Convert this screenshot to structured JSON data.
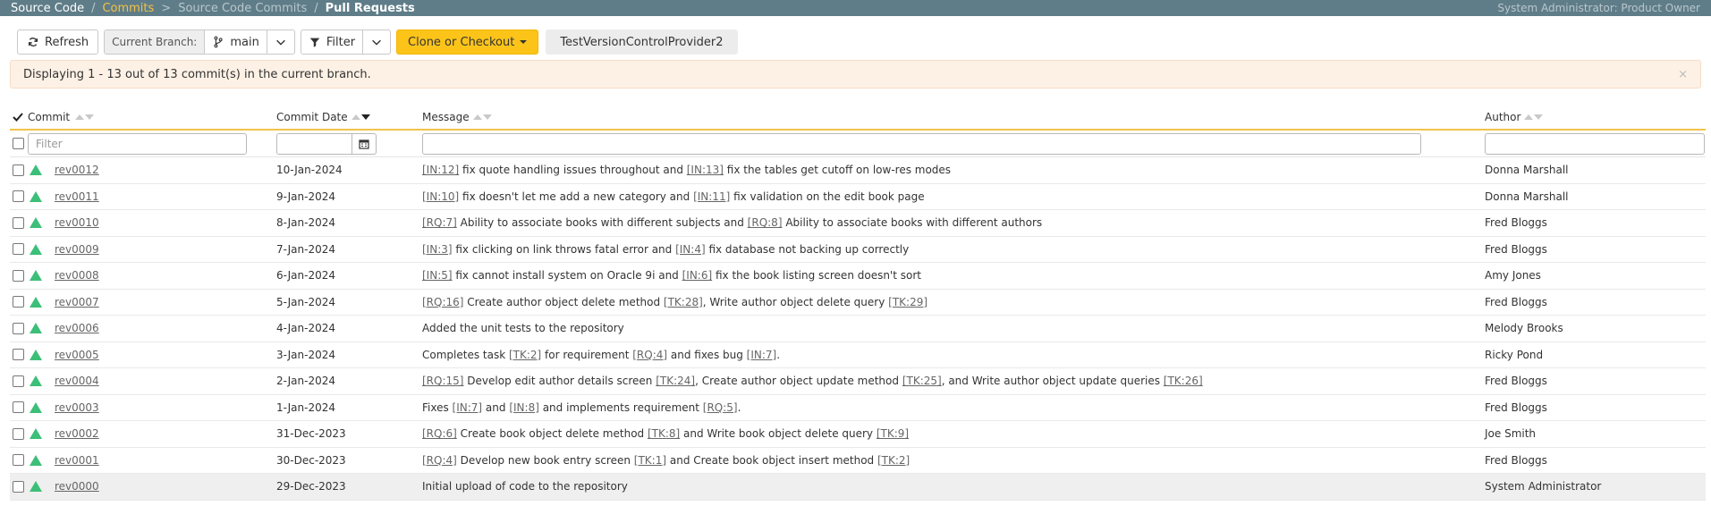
{
  "breadcrumb": {
    "items": [
      "Source Code",
      "Commits",
      "Source Code Commits",
      "Pull Requests"
    ],
    "separators": [
      "/",
      ">",
      "/"
    ]
  },
  "user": "System Administrator: Product Owner",
  "toolbar": {
    "refresh": "Refresh",
    "current_branch_label": "Current Branch:",
    "branch": "main",
    "filter": "Filter",
    "clone": "Clone or Checkout",
    "provider": "TestVersionControlProvider2"
  },
  "alert": {
    "text": "Displaying 1 - 13 out of 13 commit(s) in the current branch.",
    "close": "×"
  },
  "columns": {
    "commit": "Commit",
    "date": "Commit Date",
    "message": "Message",
    "author": "Author"
  },
  "filters": {
    "commit_placeholder": "Filter"
  },
  "rows": [
    {
      "rev": "rev0012",
      "date": "10-Jan-2024",
      "author": "Donna Marshall",
      "msg": [
        {
          "t": "IN:12",
          "l": true
        },
        {
          "t": " fix quote handling issues throughout and "
        },
        {
          "t": "IN:13",
          "l": true
        },
        {
          "t": " fix the tables get cutoff on low-res modes"
        }
      ]
    },
    {
      "rev": "rev0011",
      "date": "9-Jan-2024",
      "author": "Donna Marshall",
      "msg": [
        {
          "t": "IN:10",
          "l": true
        },
        {
          "t": " fix doesn't let me add a new category and "
        },
        {
          "t": "IN:11",
          "l": true
        },
        {
          "t": " fix validation on the edit book page"
        }
      ]
    },
    {
      "rev": "rev0010",
      "date": "8-Jan-2024",
      "author": "Fred Bloggs",
      "msg": [
        {
          "t": "RQ:7",
          "l": true
        },
        {
          "t": " Ability to associate books with different subjects and "
        },
        {
          "t": "RQ:8",
          "l": true
        },
        {
          "t": " Ability to associate books with different authors"
        }
      ]
    },
    {
      "rev": "rev0009",
      "date": "7-Jan-2024",
      "author": "Fred Bloggs",
      "msg": [
        {
          "t": "IN:3",
          "l": true
        },
        {
          "t": " fix clicking on link throws fatal error and "
        },
        {
          "t": "IN:4",
          "l": true
        },
        {
          "t": " fix database not backing up correctly"
        }
      ]
    },
    {
      "rev": "rev0008",
      "date": "6-Jan-2024",
      "author": "Amy Jones",
      "msg": [
        {
          "t": "IN:5",
          "l": true
        },
        {
          "t": " fix cannot install system on Oracle 9i and "
        },
        {
          "t": "IN:6",
          "l": true
        },
        {
          "t": " fix the book listing screen doesn't sort"
        }
      ]
    },
    {
      "rev": "rev0007",
      "date": "5-Jan-2024",
      "author": "Fred Bloggs",
      "msg": [
        {
          "t": "RQ:16",
          "l": true
        },
        {
          "t": " Create author object delete method "
        },
        {
          "t": "TK:28",
          "l": true
        },
        {
          "t": ", Write author object delete query "
        },
        {
          "t": "TK:29",
          "l": true
        }
      ]
    },
    {
      "rev": "rev0006",
      "date": "4-Jan-2024",
      "author": "Melody Brooks",
      "msg": [
        {
          "t": "Added the unit tests to the repository"
        }
      ]
    },
    {
      "rev": "rev0005",
      "date": "3-Jan-2024",
      "author": "Ricky Pond",
      "msg": [
        {
          "t": "Completes task "
        },
        {
          "t": "TK:2",
          "l": true
        },
        {
          "t": " for requirement "
        },
        {
          "t": "RQ:4",
          "l": true
        },
        {
          "t": " and fixes bug "
        },
        {
          "t": "IN:7",
          "l": true
        },
        {
          "t": "."
        }
      ]
    },
    {
      "rev": "rev0004",
      "date": "2-Jan-2024",
      "author": "Fred Bloggs",
      "msg": [
        {
          "t": "RQ:15",
          "l": true
        },
        {
          "t": " Develop edit author details screen "
        },
        {
          "t": "TK:24",
          "l": true
        },
        {
          "t": ", Create author object update method "
        },
        {
          "t": "TK:25",
          "l": true
        },
        {
          "t": ", and Write author object update queries "
        },
        {
          "t": "TK:26",
          "l": true
        }
      ]
    },
    {
      "rev": "rev0003",
      "date": "1-Jan-2024",
      "author": "Fred Bloggs",
      "msg": [
        {
          "t": "Fixes "
        },
        {
          "t": "IN:7",
          "l": true
        },
        {
          "t": " and "
        },
        {
          "t": "IN:8",
          "l": true
        },
        {
          "t": " and implements requirement "
        },
        {
          "t": "RQ:5",
          "l": true
        },
        {
          "t": "."
        }
      ]
    },
    {
      "rev": "rev0002",
      "date": "31-Dec-2023",
      "author": "Joe Smith",
      "msg": [
        {
          "t": "RQ:6",
          "l": true
        },
        {
          "t": " Create book object delete method "
        },
        {
          "t": "TK:8",
          "l": true
        },
        {
          "t": " and Write book object delete query "
        },
        {
          "t": "TK:9",
          "l": true
        }
      ]
    },
    {
      "rev": "rev0001",
      "date": "30-Dec-2023",
      "author": "Fred Bloggs",
      "msg": [
        {
          "t": "RQ:4",
          "l": true
        },
        {
          "t": " Develop new book entry screen "
        },
        {
          "t": "TK:1",
          "l": true
        },
        {
          "t": " and Create book object insert method "
        },
        {
          "t": "TK:2",
          "l": true
        }
      ]
    },
    {
      "rev": "rev0000",
      "date": "29-Dec-2023",
      "author": "System Administrator",
      "msg": [
        {
          "t": "Initial upload of code to the repository"
        }
      ]
    }
  ],
  "colors": {
    "topbar": "#5f7d88",
    "accent": "#f5c242",
    "clone": "#fcc419",
    "success": "#3cbf78"
  }
}
